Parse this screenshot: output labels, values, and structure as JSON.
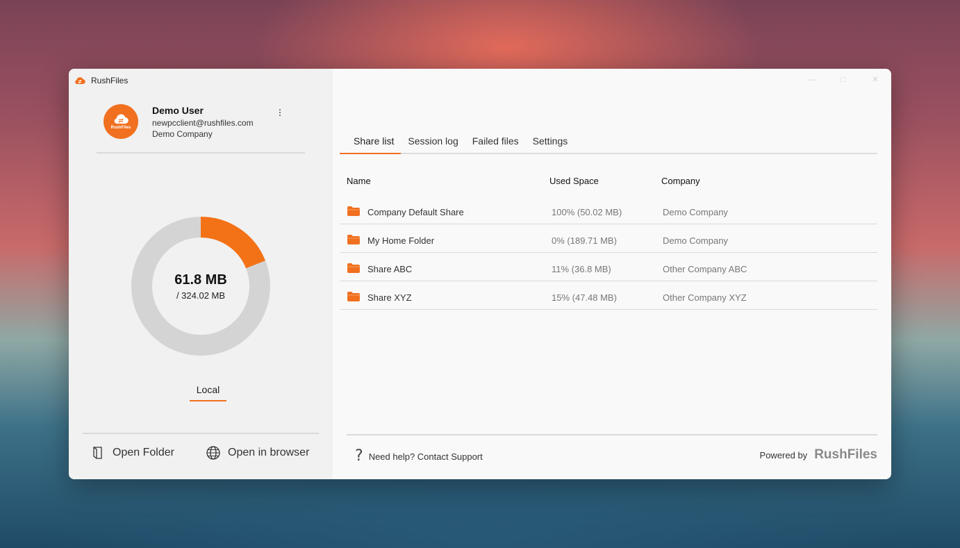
{
  "window": {
    "title": "RushFiles"
  },
  "user": {
    "name": "Demo User",
    "email": "newpcclient@rushfiles.com",
    "company": "Demo Company",
    "avatar_text": "RushFiles"
  },
  "storage": {
    "used_label": "61.8 MB",
    "total_label": "/ 324.02 MB",
    "used_fraction": 0.19,
    "used_color": "#f47216",
    "track_color": "#d4d4d4"
  },
  "left_tab": {
    "label": "Local"
  },
  "actions": {
    "open_folder": "Open Folder",
    "open_browser": "Open in browser"
  },
  "tabs": [
    {
      "label": "Share list",
      "active": true
    },
    {
      "label": "Session log",
      "active": false
    },
    {
      "label": "Failed files",
      "active": false
    },
    {
      "label": "Settings",
      "active": false
    }
  ],
  "table": {
    "headers": {
      "name": "Name",
      "used": "Used Space",
      "company": "Company"
    },
    "rows": [
      {
        "name": "Company Default Share",
        "used": "100% (50.02 MB)",
        "company": "Demo Company"
      },
      {
        "name": "My Home Folder",
        "used": "0% (189.71 MB)",
        "company": "Demo Company"
      },
      {
        "name": "Share ABC",
        "used": "11% (36.8 MB)",
        "company": "Other Company ABC"
      },
      {
        "name": "Share XYZ",
        "used": "15% (47.48 MB)",
        "company": "Other Company XYZ"
      }
    ]
  },
  "footer": {
    "help": "Need help? Contact Support",
    "powered_by": "Powered by",
    "brand": "RushFiles"
  },
  "colors": {
    "accent": "#f07020"
  },
  "icons": {
    "app": "rushfiles-cloud-icon",
    "folder": "folder-icon",
    "open_folder": "open-folder-icon",
    "browser": "globe-icon",
    "help": "question-icon",
    "menu": "kebab-menu-icon"
  }
}
